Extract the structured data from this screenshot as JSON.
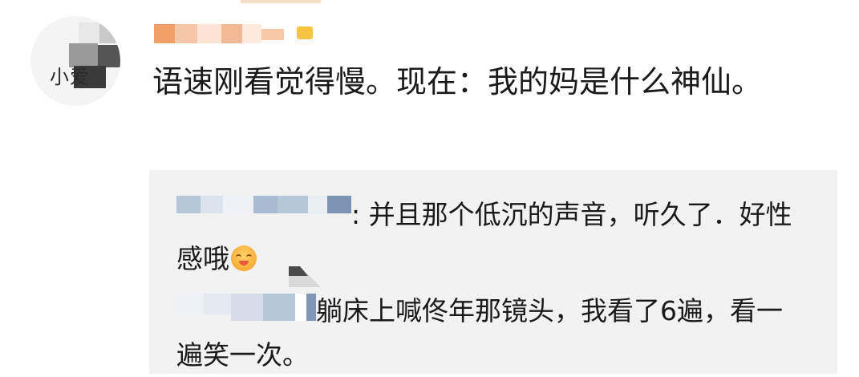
{
  "comment": {
    "avatar_text": "小爱",
    "text": "语速刚看觉得慢。现在：我的妈是什么神仙。"
  },
  "replies": [
    {
      "separator": ": ",
      "text": "并且那个低沉的声音，听久了．好性感哦"
    },
    {
      "text": "躺床上喊佟年那镜头，我看了6遍，看一遍笑一次。"
    }
  ],
  "icons": {
    "emoji": "blush-smile-emoji",
    "badge": "vip-badge-icon"
  },
  "colors": {
    "reply_background": "#f2f2f2",
    "text": "#1a1a1a",
    "badge": "#f5c542"
  }
}
